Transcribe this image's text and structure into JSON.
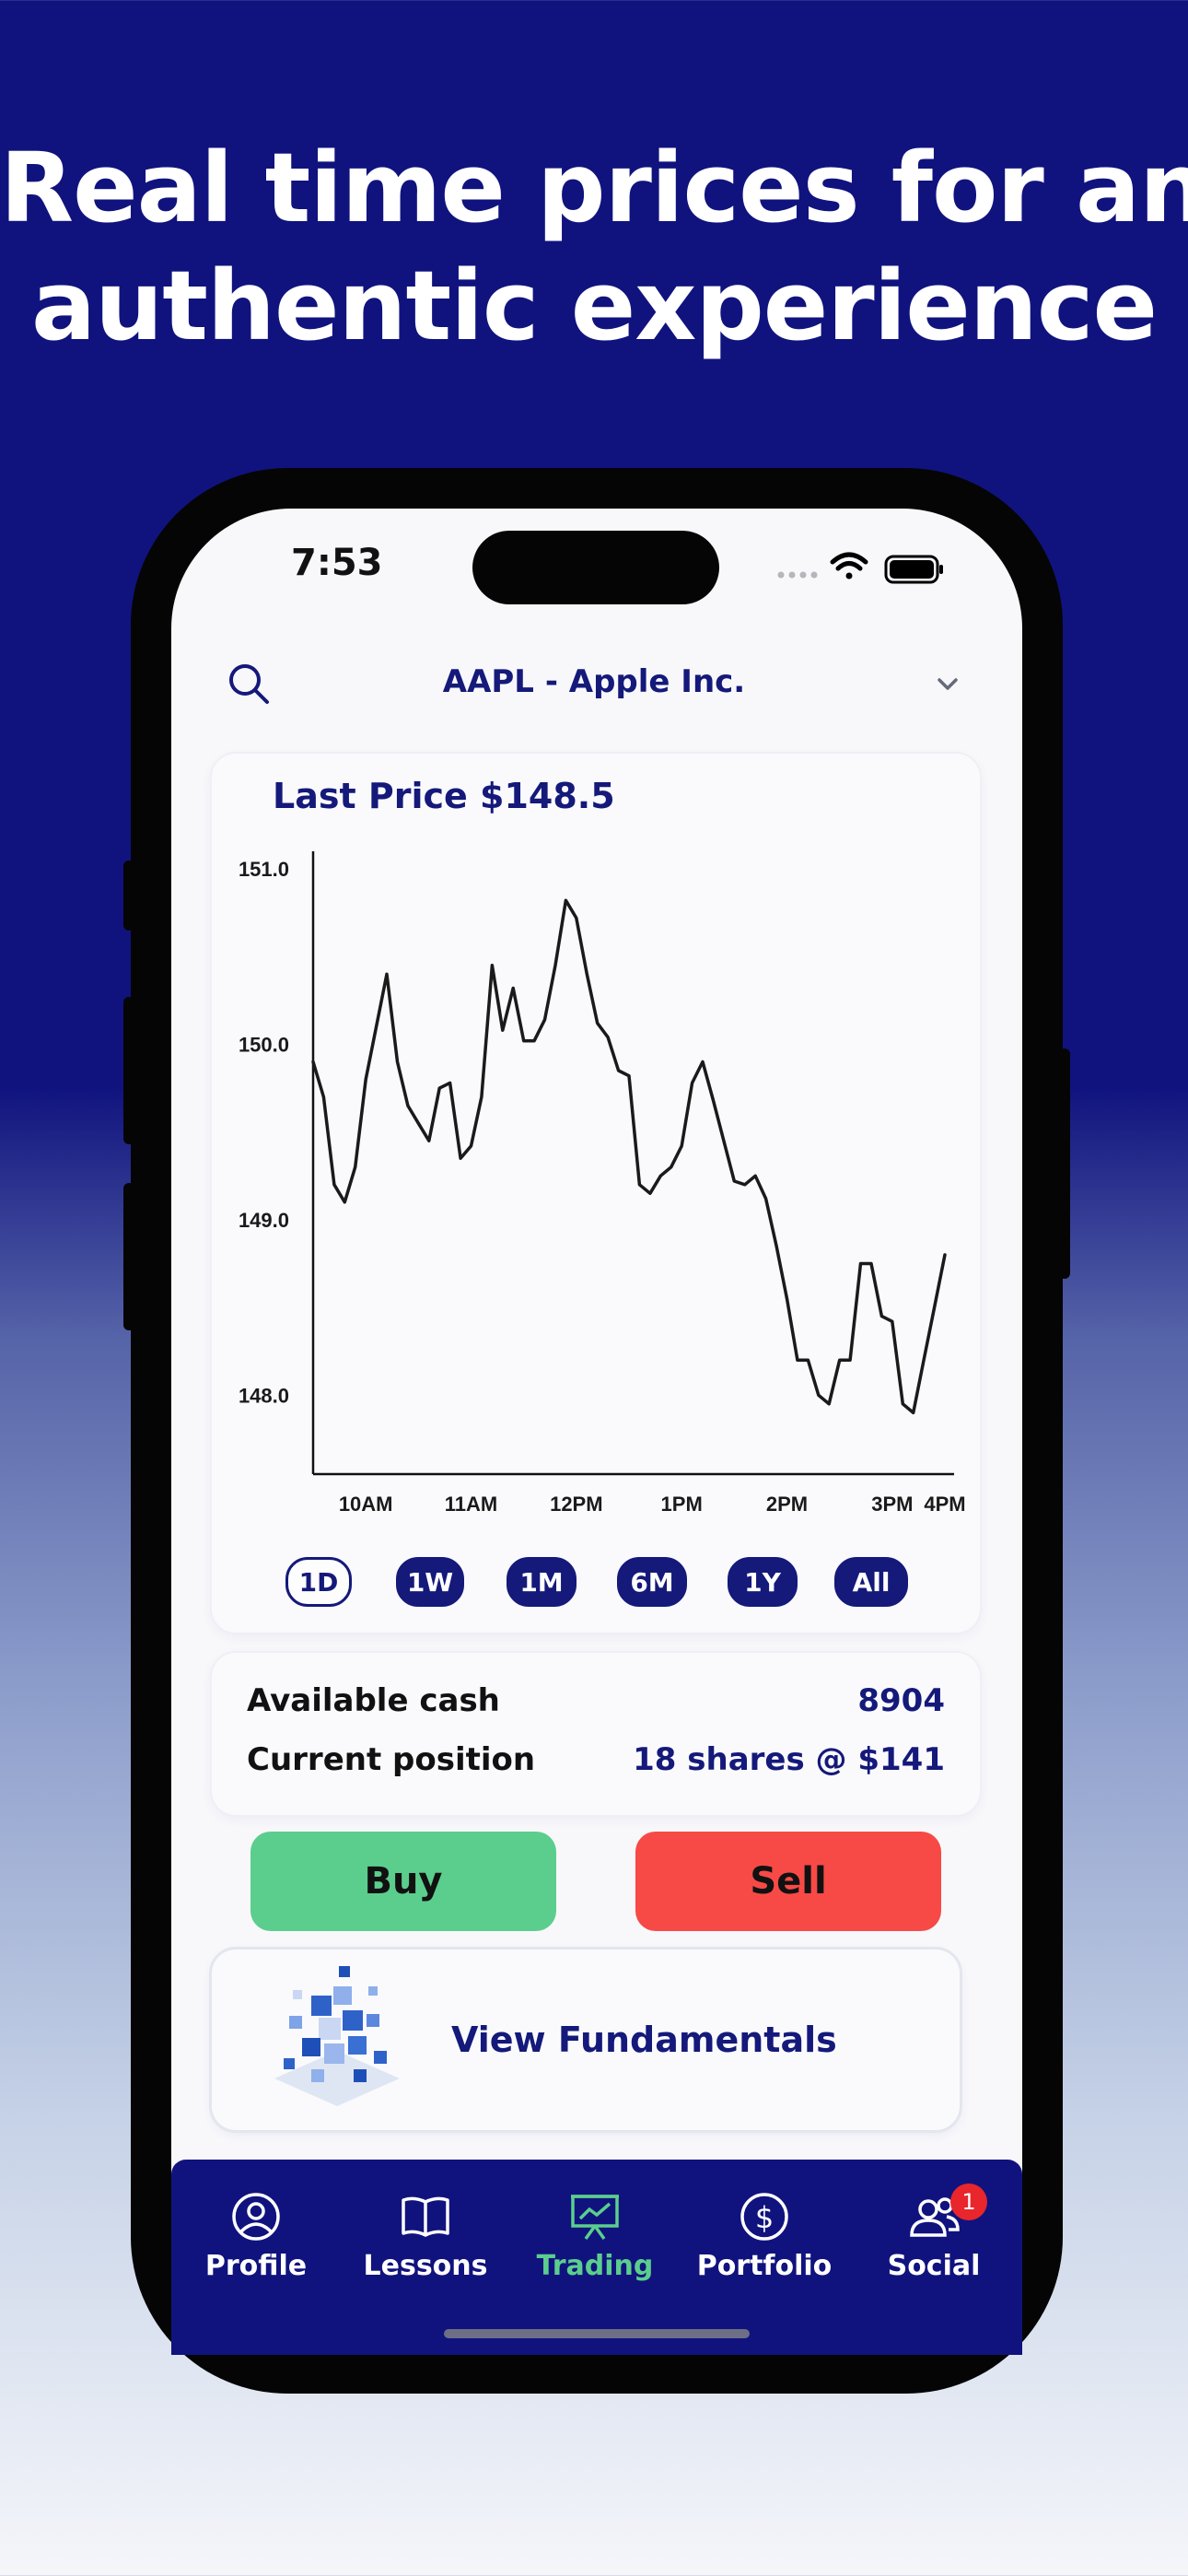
{
  "headline": {
    "line1": "Real time prices for an",
    "line2": "authentic experience"
  },
  "status_bar": {
    "time": "7:53",
    "icons": [
      "signal-icon",
      "wifi-icon",
      "battery-icon"
    ]
  },
  "header": {
    "search_icon": "search-icon",
    "ticker": "AAPL - Apple Inc.",
    "dropdown_icon": "chevron-down-icon"
  },
  "chart_card": {
    "last_price_label": "Last Price $148.5"
  },
  "chart_data": {
    "type": "line",
    "x_ticks": [
      "10AM",
      "11AM",
      "12PM",
      "1PM",
      "2PM",
      "3PM",
      "4PM"
    ],
    "y_ticks": [
      "151.0",
      "150.0",
      "149.0",
      "148.0"
    ],
    "ylim": [
      147.55,
      151.1
    ],
    "xlim": [
      0,
      60
    ],
    "grid": false,
    "series": [
      {
        "x": [
          0,
          1,
          2,
          3,
          4,
          5,
          6,
          7,
          8,
          9,
          10,
          11,
          12,
          13,
          14,
          15,
          16,
          17,
          18,
          19,
          20,
          21,
          22,
          23,
          24,
          25,
          26,
          27,
          28,
          29,
          30,
          31,
          32,
          33,
          34,
          35,
          36,
          37,
          38,
          39,
          40,
          41,
          42,
          43,
          44,
          45,
          46,
          47,
          48,
          49,
          50,
          51,
          52,
          53,
          54,
          55,
          56,
          57,
          58,
          59,
          60
        ],
        "values": [
          149.9,
          149.7,
          149.2,
          149.1,
          149.3,
          149.8,
          150.1,
          150.4,
          149.9,
          149.65,
          149.55,
          149.45,
          149.75,
          149.78,
          149.35,
          149.42,
          149.7,
          150.45,
          150.08,
          150.32,
          150.02,
          150.02,
          150.14,
          150.45,
          150.82,
          150.72,
          150.4,
          150.12,
          150.04,
          149.85,
          149.82,
          149.2,
          149.15,
          149.25,
          149.3,
          149.42,
          149.78,
          149.9,
          149.68,
          149.45,
          149.22,
          149.2,
          149.25,
          149.12,
          148.85,
          148.55,
          148.2,
          148.2,
          148.0,
          147.95,
          148.2,
          148.2,
          148.75,
          148.75,
          148.45,
          148.42,
          147.95,
          147.9,
          148.2,
          148.5,
          148.8
        ],
        "x_domain_note": "",
        "color": "#1a1a1a"
      }
    ]
  },
  "range_buttons": [
    {
      "label": "1D",
      "active": true
    },
    {
      "label": "1W",
      "active": false
    },
    {
      "label": "1M",
      "active": false
    },
    {
      "label": "6M",
      "active": false
    },
    {
      "label": "1Y",
      "active": false
    },
    {
      "label": "All",
      "active": false
    }
  ],
  "account": {
    "cash_label": "Available cash",
    "cash_value": "8904",
    "position_label": "Current position",
    "position_value": "18 shares @ $141"
  },
  "actions": {
    "buy_label": "Buy",
    "sell_label": "Sell"
  },
  "fundamentals": {
    "label": "View Fundamentals",
    "icon": "data-cubes-icon"
  },
  "tabs": [
    {
      "label": "Profile",
      "icon": "profile-icon",
      "active": false
    },
    {
      "label": "Lessons",
      "icon": "book-icon",
      "active": false
    },
    {
      "label": "Trading",
      "icon": "chart-board-icon",
      "active": true
    },
    {
      "label": "Portfolio",
      "icon": "dollar-icon",
      "active": false
    },
    {
      "label": "Social",
      "icon": "users-icon",
      "active": false,
      "badge": "1"
    }
  ],
  "colors": {
    "brand_navy": "#14197a",
    "buy_green": "#5bce8d",
    "sell_red": "#f74a46",
    "badge_red": "#e8262c"
  }
}
